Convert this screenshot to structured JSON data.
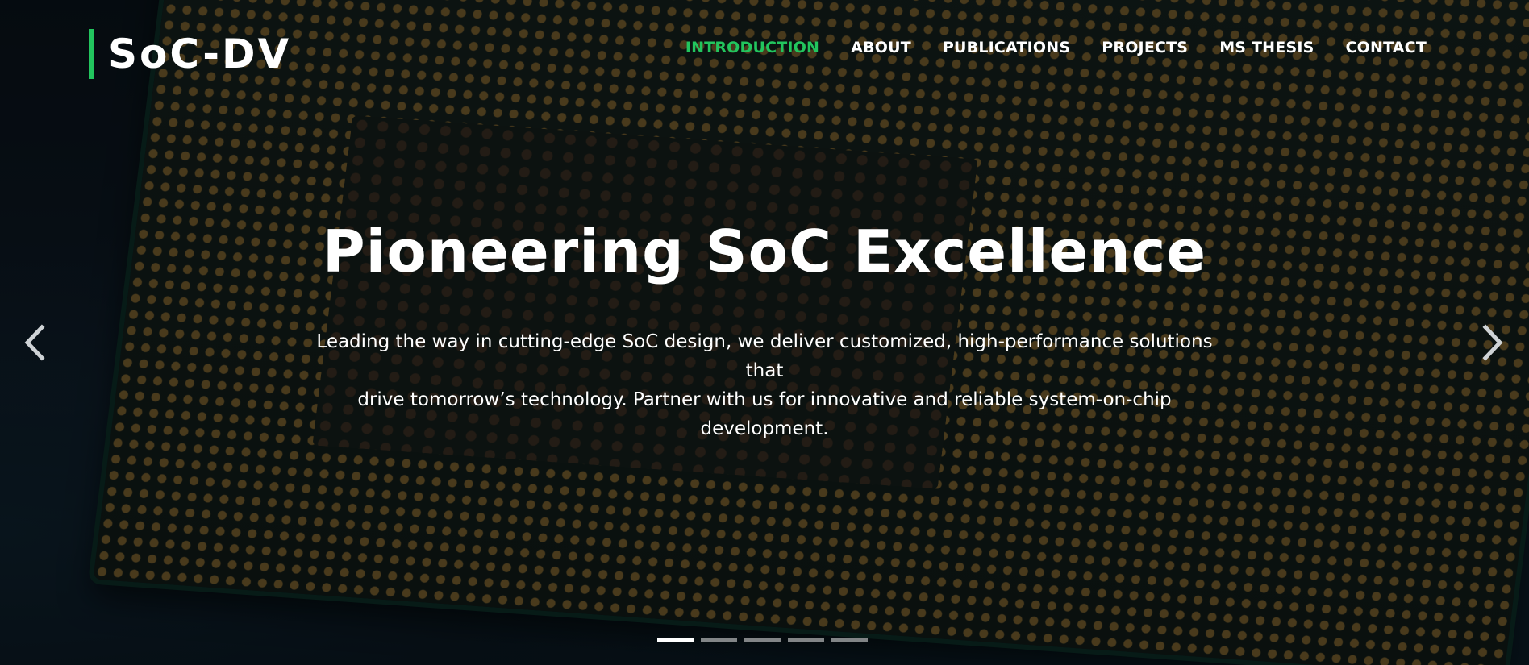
{
  "brand": {
    "logo_text": "SoC-DV",
    "accent_color": "#22c55e"
  },
  "nav": {
    "items": [
      {
        "label": "INTRODUCTION",
        "active": true
      },
      {
        "label": "ABOUT",
        "active": false
      },
      {
        "label": "PUBLICATIONS",
        "active": false
      },
      {
        "label": "PROJECTS",
        "active": false
      },
      {
        "label": "MS THESIS",
        "active": false
      },
      {
        "label": "CONTACT",
        "active": false
      }
    ]
  },
  "hero": {
    "title": "Pioneering SoC Excellence",
    "text_line1": "Leading the way in cutting-edge SoC design, we deliver customized, high-performance solutions that",
    "text_line2": "drive tomorrow’s technology. Partner with us for innovative and reliable system-on-chip",
    "text_line3": "development."
  },
  "carousel": {
    "prev_icon": "chevron-left-icon",
    "next_icon": "chevron-right-icon",
    "slide_count": 5,
    "active_slide": 1
  }
}
